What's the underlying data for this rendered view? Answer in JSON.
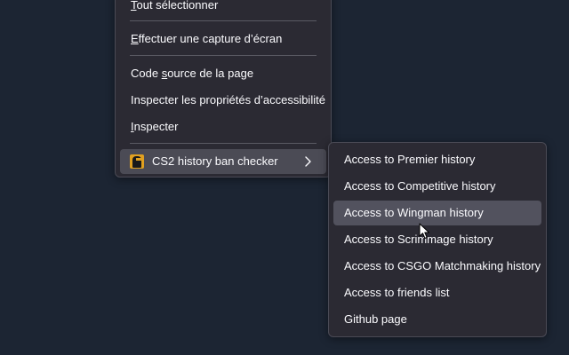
{
  "main_menu": {
    "items": [
      {
        "pre": "",
        "ul": "T",
        "post": "out sélectionner"
      },
      {
        "pre": "",
        "ul": "E",
        "post": "ffectuer une capture d’écran"
      },
      {
        "pre": "Code ",
        "ul": "s",
        "post": "ource de la page"
      },
      {
        "pre": "Inspecter les propriétés d’accessibilité",
        "ul": "",
        "post": ""
      },
      {
        "pre": "",
        "ul": "I",
        "post": "nspecter"
      }
    ],
    "extension": {
      "label": "CS2 history ban checker",
      "icon": "cs2-extension-icon"
    }
  },
  "sub_menu": {
    "items": [
      {
        "label": "Access to Premier history"
      },
      {
        "label": "Access to Competitive history"
      },
      {
        "label": "Access to Wingman history"
      },
      {
        "label": "Access to Scrimmage history"
      },
      {
        "label": "Access to CSGO Matchmaking history"
      },
      {
        "label": "Access to friends list"
      },
      {
        "label": "Github page"
      }
    ]
  },
  "colors": {
    "desktop_bg": "#1c2533",
    "menu_bg": "#2b2a33",
    "menu_text": "#fbfbfe",
    "hover_bg": "#52525e"
  }
}
